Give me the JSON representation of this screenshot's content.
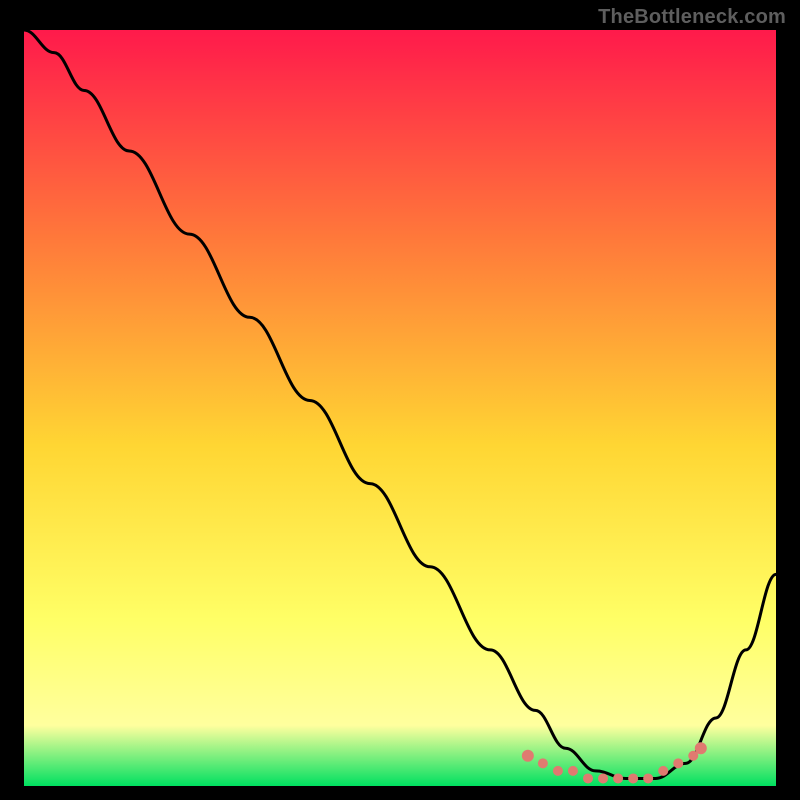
{
  "attribution": "TheBottleneck.com",
  "colors": {
    "gradient_top": "#ff1a4b",
    "gradient_mid1": "#ff7a3a",
    "gradient_mid2": "#ffd633",
    "gradient_mid3": "#ffff66",
    "gradient_mid4": "#ffff9e",
    "gradient_bottom": "#00e060",
    "curve": "#000000",
    "dots": "#e07a70"
  },
  "chart_data": {
    "type": "line",
    "title": "",
    "xlabel": "",
    "ylabel": "",
    "xlim": [
      0,
      100
    ],
    "ylim": [
      0,
      100
    ],
    "grid": false,
    "series": [
      {
        "name": "bottleneck-curve",
        "x": [
          0,
          4,
          8,
          14,
          22,
          30,
          38,
          46,
          54,
          62,
          68,
          72,
          76,
          80,
          84,
          88,
          92,
          96,
          100
        ],
        "y": [
          100,
          97,
          92,
          84,
          73,
          62,
          51,
          40,
          29,
          18,
          10,
          5,
          2,
          1,
          1,
          3,
          9,
          18,
          28
        ]
      }
    ],
    "highlight_points": {
      "name": "optimal-range-dots",
      "x": [
        67,
        69,
        71,
        73,
        75,
        77,
        79,
        81,
        83,
        85,
        87,
        89,
        90
      ],
      "y": [
        4,
        3,
        2,
        2,
        1,
        1,
        1,
        1,
        1,
        2,
        3,
        4,
        5
      ]
    }
  }
}
